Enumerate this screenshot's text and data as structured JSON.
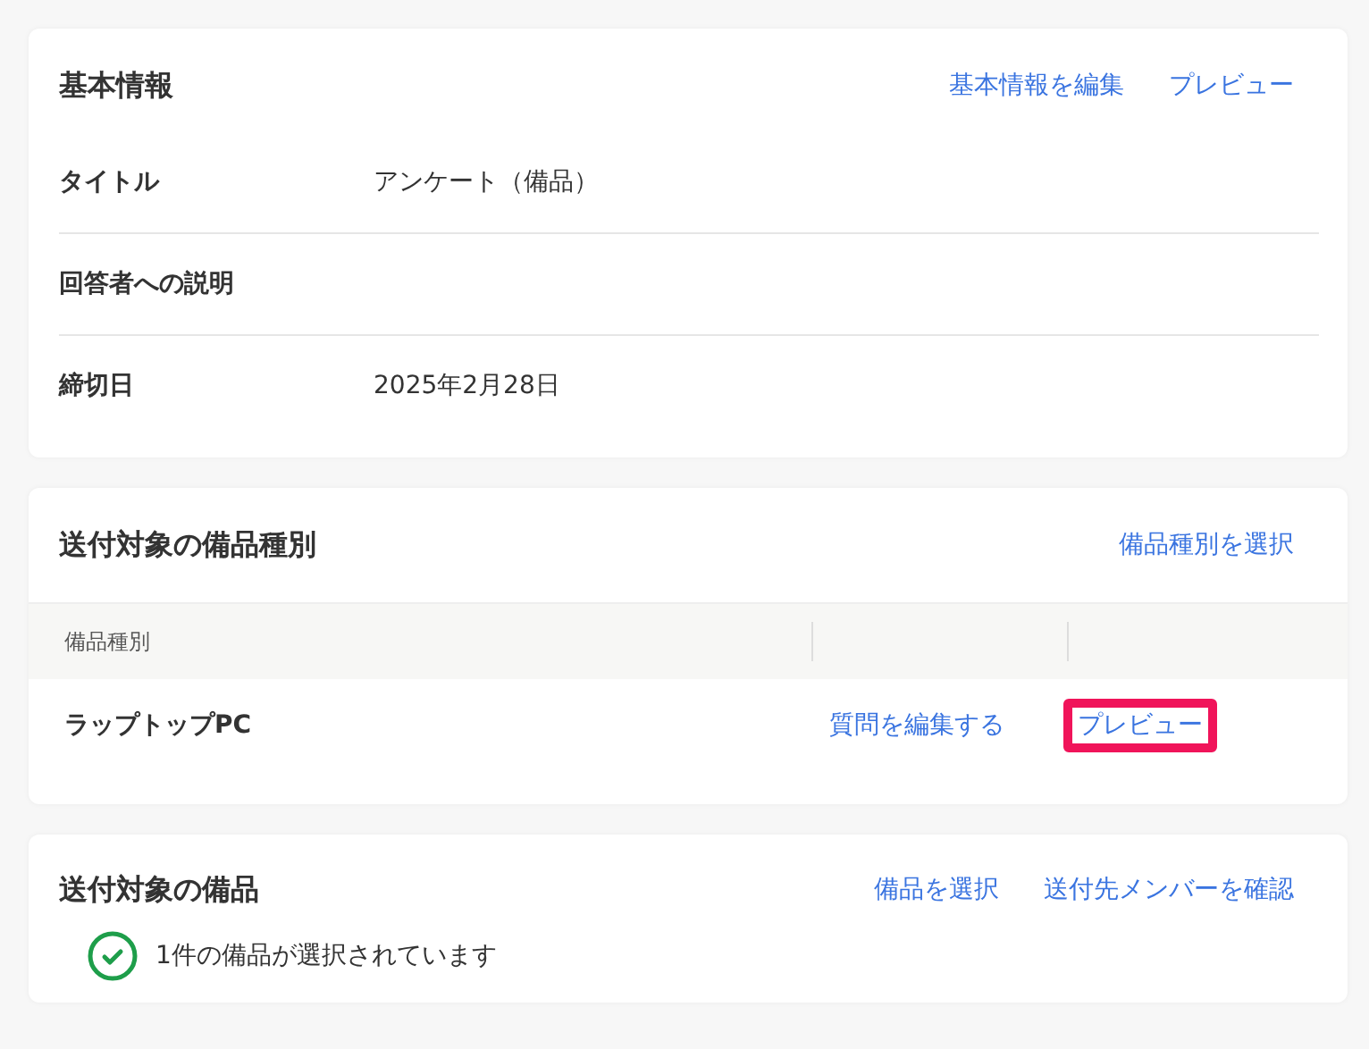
{
  "basic_info": {
    "title": "基本情報",
    "actions": [
      {
        "label": "基本情報を編集"
      },
      {
        "label": "プレビュー"
      }
    ],
    "fields": [
      {
        "label": "タイトル",
        "value": "アンケート（備品）"
      },
      {
        "label": "回答者への説明"
      },
      {
        "label": "締切日",
        "value": "2025年2月28日"
      }
    ]
  },
  "equipment_types": {
    "title": "送付対象の備品種別",
    "actions": [
      {
        "label": "備品種別を選択"
      }
    ],
    "table": {
      "columns": [
        "備品種別"
      ],
      "rows": [
        {
          "name": "ラップトップPC",
          "actions": [
            {
              "label": "質問を編集する",
              "highlighted": false
            },
            {
              "label": "プレビュー",
              "highlighted": true
            }
          ]
        }
      ]
    }
  },
  "equipment": {
    "title": "送付対象の備品",
    "actions": [
      {
        "label": "備品を選択"
      },
      {
        "label": "送付先メンバーを確認"
      }
    ],
    "status": {
      "ok": true,
      "text": "1件の備品が選択されています"
    }
  }
}
